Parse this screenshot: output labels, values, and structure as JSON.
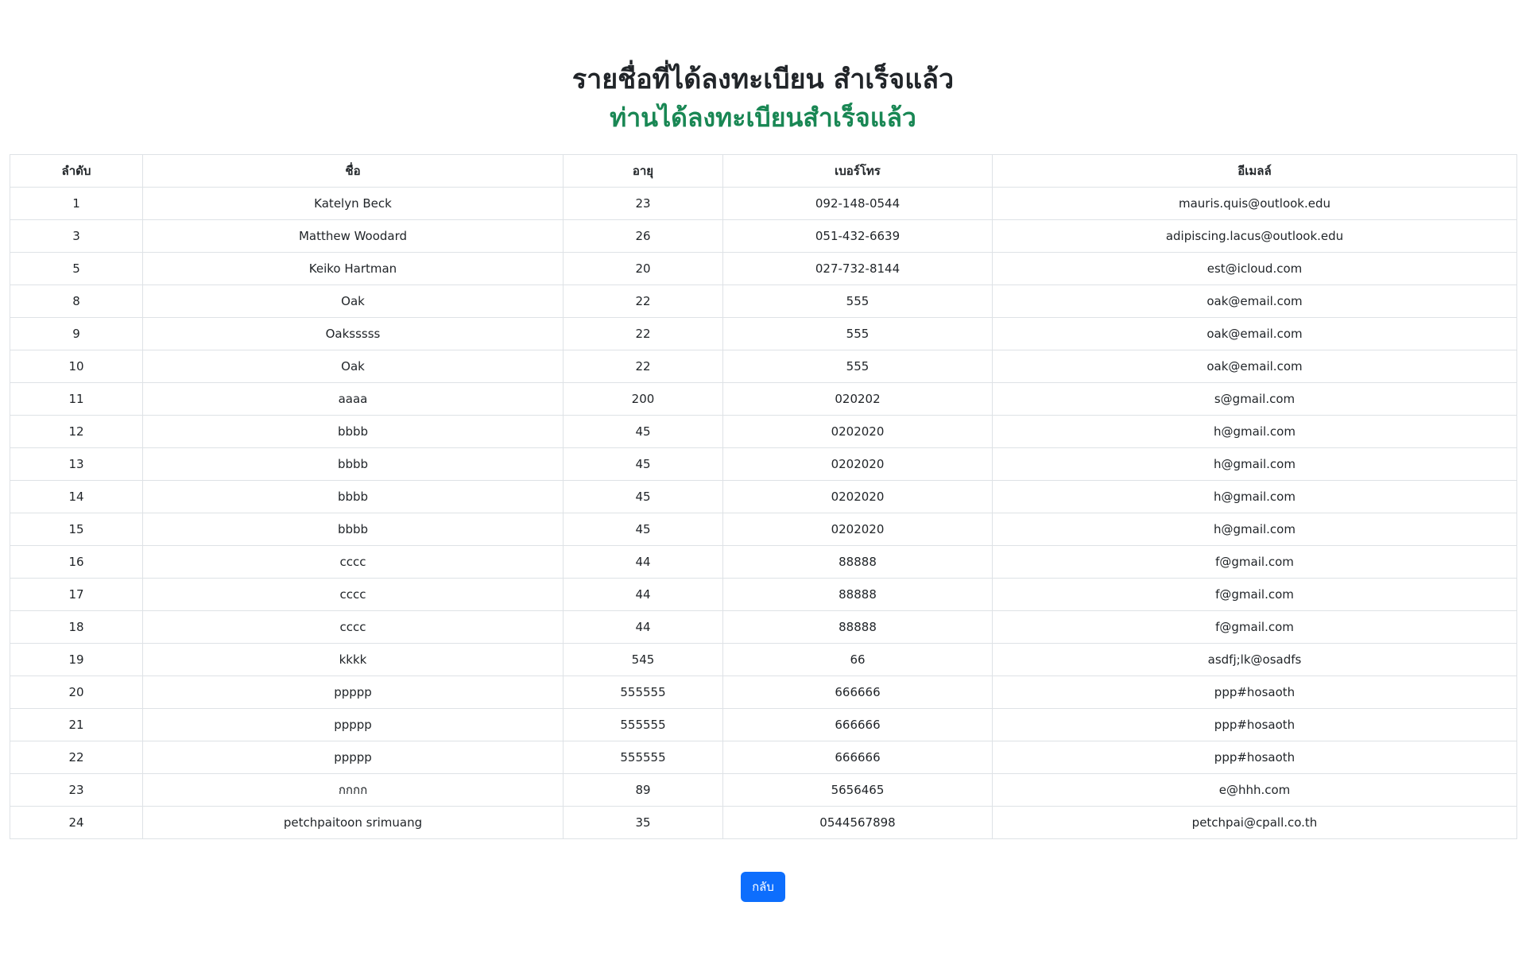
{
  "header": {
    "title": "รายชื่อที่ได้ลงทะเบียน สำเร็จแล้ว",
    "subtitle": "ท่านได้ลงทะเบียนสำเร็จแล้ว"
  },
  "table": {
    "columns": [
      "ลำดับ",
      "ชื่อ",
      "อายุ",
      "เบอร์โทร",
      "อีเมลล์"
    ],
    "rows": [
      [
        "1",
        "Katelyn Beck",
        "23",
        "092-148-0544",
        "mauris.quis@outlook.edu"
      ],
      [
        "3",
        "Matthew Woodard",
        "26",
        "051-432-6639",
        "adipiscing.lacus@outlook.edu"
      ],
      [
        "5",
        "Keiko Hartman",
        "20",
        "027-732-8144",
        "est@icloud.com"
      ],
      [
        "8",
        "Oak",
        "22",
        "555",
        "oak@email.com"
      ],
      [
        "9",
        "Oaksssss",
        "22",
        "555",
        "oak@email.com"
      ],
      [
        "10",
        "Oak",
        "22",
        "555",
        "oak@email.com"
      ],
      [
        "11",
        "aaaa",
        "200",
        "020202",
        "s@gmail.com"
      ],
      [
        "12",
        "bbbb",
        "45",
        "0202020",
        "h@gmail.com"
      ],
      [
        "13",
        "bbbb",
        "45",
        "0202020",
        "h@gmail.com"
      ],
      [
        "14",
        "bbbb",
        "45",
        "0202020",
        "h@gmail.com"
      ],
      [
        "15",
        "bbbb",
        "45",
        "0202020",
        "h@gmail.com"
      ],
      [
        "16",
        "cccc",
        "44",
        "88888",
        "f@gmail.com"
      ],
      [
        "17",
        "cccc",
        "44",
        "88888",
        "f@gmail.com"
      ],
      [
        "18",
        "cccc",
        "44",
        "88888",
        "f@gmail.com"
      ],
      [
        "19",
        "kkkk",
        "545",
        "66",
        "asdfj;lk@osadfs"
      ],
      [
        "20",
        "ppppp",
        "555555",
        "666666",
        "ppp#hosaoth"
      ],
      [
        "21",
        "ppppp",
        "555555",
        "666666",
        "ppp#hosaoth"
      ],
      [
        "22",
        "ppppp",
        "555555",
        "666666",
        "ppp#hosaoth"
      ],
      [
        "23",
        "กกกก",
        "89",
        "5656465",
        "e@hhh.com"
      ],
      [
        "24",
        "petchpaitoon srimuang",
        "35",
        "0544567898",
        "petchpai@cpall.co.th"
      ]
    ]
  },
  "actions": {
    "back_label": "กลับ"
  },
  "colors": {
    "subtitle": "#198754",
    "button": "#0d6efd",
    "border": "#dee2e6"
  }
}
